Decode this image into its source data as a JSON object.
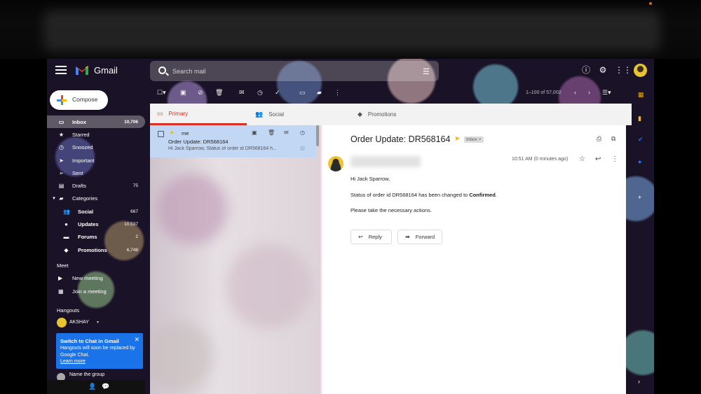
{
  "header": {
    "app_name": "Gmail",
    "search_placeholder": "Search mail",
    "icons": [
      "main-menu-icon",
      "search-icon",
      "search-options-icon",
      "help-icon",
      "settings-icon",
      "apps-icon"
    ]
  },
  "compose": {
    "label": "Compose"
  },
  "sidebar": {
    "items": [
      {
        "label": "Inbox",
        "count": "10,706",
        "icon": "inbox-icon"
      },
      {
        "label": "Starred",
        "count": "",
        "icon": "star-icon"
      },
      {
        "label": "Snoozed",
        "count": "",
        "icon": "clock-icon"
      },
      {
        "label": "Important",
        "count": "",
        "icon": "label-important-icon"
      },
      {
        "label": "Sent",
        "count": "",
        "icon": "send-icon"
      },
      {
        "label": "Drafts",
        "count": "75",
        "icon": "draft-icon"
      },
      {
        "label": "Categories",
        "count": "",
        "icon": "label-icon"
      },
      {
        "label": "Social",
        "count": "667",
        "icon": "people-icon"
      },
      {
        "label": "Updates",
        "count": "10,537",
        "icon": "info-icon"
      },
      {
        "label": "Forums",
        "count": "2",
        "icon": "forum-icon"
      },
      {
        "label": "Promotions",
        "count": "6,748",
        "icon": "tag-icon"
      }
    ],
    "meet": {
      "title": "Meet",
      "new_meeting": "New meeting",
      "join_meeting": "Join a meeting"
    },
    "hangouts": {
      "title": "Hangouts",
      "user": "AKSHAY",
      "card_title": "Switch to Chat in Gmail",
      "card_body": "Hangouts will soon be replaced by Google Chat.",
      "card_link": "Learn more",
      "name_group": "Name the group"
    }
  },
  "toolbar": {
    "pagination": "1–100 of 57,002"
  },
  "tabs": [
    {
      "label": "Primary"
    },
    {
      "label": "Social"
    },
    {
      "label": "Promotions"
    }
  ],
  "message_list": [
    {
      "from": "me",
      "subject": "Order Update: DR568164",
      "snippet": "Hi Jack Sparrow, Status of order id DR568164 h..."
    }
  ],
  "reader": {
    "subject": "Order Update: DR568164",
    "label": "Inbox ×",
    "time": "10:51 AM (0 minutes ago)",
    "greeting": "Hi Jack Sparrow,",
    "status_text": "Status of order id DR568164 has been changed to ",
    "status_value": "Confirmed",
    "status_end": ".",
    "action_text": "Please take the necessary actions.",
    "reply_label": "Reply",
    "forward_label": "Forward"
  },
  "colors": {
    "accent_red": "#d93025",
    "selected_row": "#c2d7f4",
    "chat_card": "#1a73e8",
    "important_marker": "#f2b400"
  }
}
